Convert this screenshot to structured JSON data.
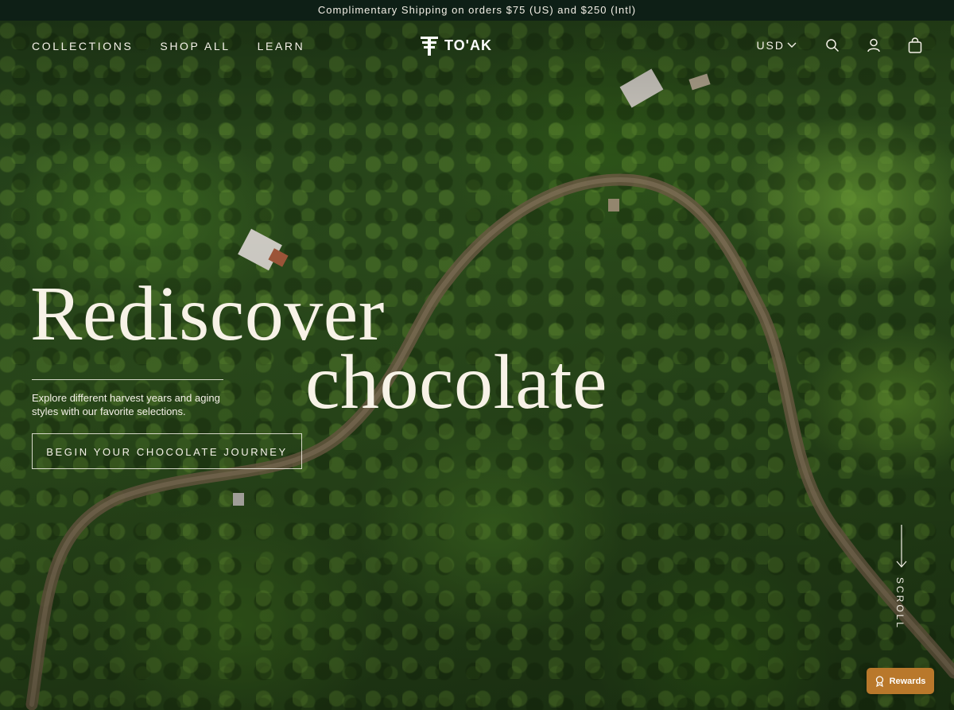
{
  "announcement": {
    "text": "Complimentary Shipping on orders $75 (US) and $250 (Intl)"
  },
  "nav": {
    "left_links": [
      {
        "label": "COLLECTIONS"
      },
      {
        "label": "SHOP ALL"
      },
      {
        "label": "LEARN"
      }
    ],
    "logo_text": "TO'AK",
    "currency": "USD",
    "icons": [
      "search-icon",
      "account-icon",
      "cart-icon"
    ]
  },
  "hero": {
    "headline_line1": "Rediscover",
    "headline_line2": "chocolate",
    "subtext": "Explore different harvest years and aging styles with our favorite selections.",
    "cta_label": "BEGIN YOUR CHOCOLATE JOURNEY",
    "scroll_label": "SCROLL"
  },
  "rewards": {
    "label": "Rewards"
  },
  "colors": {
    "announcement_bg": "#0e1f16",
    "text_light": "#f5f1e8",
    "rewards_bg": "#b9782b"
  }
}
